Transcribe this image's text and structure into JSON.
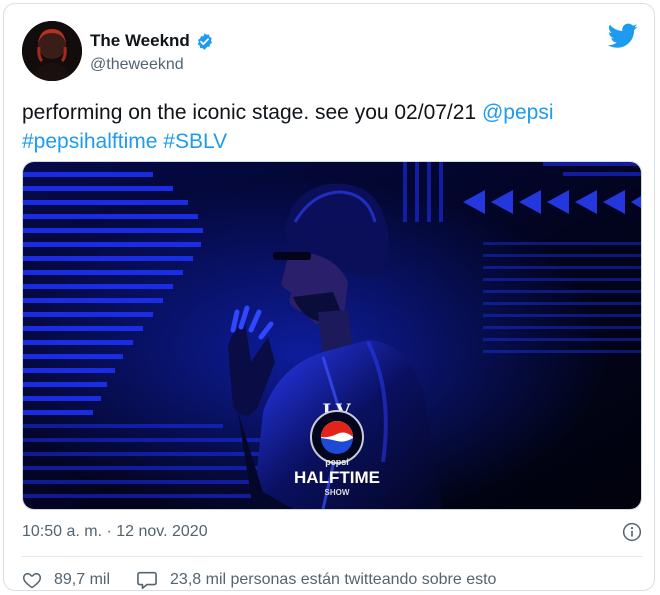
{
  "tweet": {
    "author_name": "The Weeknd",
    "author_handle": "@theweeknd",
    "text_plain": "performing on the iconic stage. see you 02/07/21 ",
    "mention": "@pepsi",
    "hashtag1": "#pepsihalftime",
    "hashtag2": "#SBLV",
    "timestamp": "10:50 a. m. · 12 nov. 2020",
    "likes": "89,7 mil",
    "conversation_text": "23,8 mil personas están twitteando sobre esto"
  },
  "media": {
    "logo_lv": "LV",
    "logo_pepsi": "pepsi",
    "logo_halftime": "HALFTIME",
    "logo_show": "SHOW"
  },
  "icons": {
    "verified": "verified-badge-icon",
    "brand": "twitter-bird-icon",
    "info": "info-icon",
    "like": "heart-icon",
    "reply": "speech-bubble-icon"
  },
  "colors": {
    "link": "#1d9bf0",
    "text": "#0f1419",
    "muted": "#536471",
    "stage_blue": "#1b2cff"
  }
}
